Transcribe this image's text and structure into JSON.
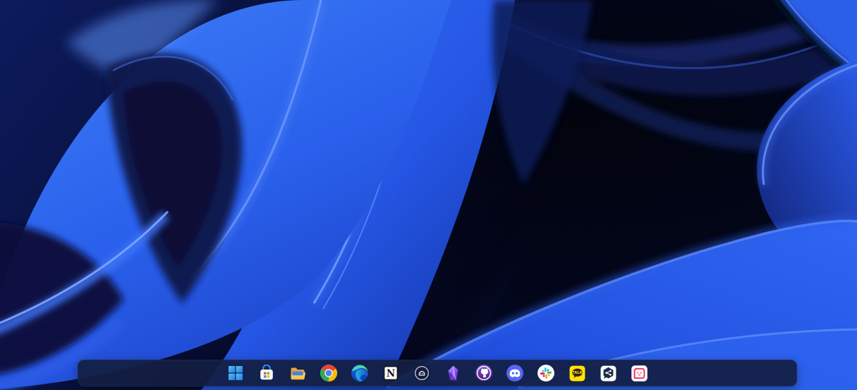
{
  "desktop": {
    "wallpaper": {
      "style": "Windows 11 bloom abstract blue ribbons",
      "colors": {
        "bright_blue": "#2e68f2",
        "highlight_blue": "#7fa7ff",
        "mid_blue": "#1a3ec2",
        "deep_navy": "#070d33",
        "near_black": "#03061a"
      }
    }
  },
  "taskbar": {
    "alignment": "center",
    "background": "#131e42",
    "items": [
      {
        "id": "start",
        "label": "Start"
      },
      {
        "id": "microsoft-store",
        "label": "Microsoft Store"
      },
      {
        "id": "file-explorer",
        "label": "File Explorer"
      },
      {
        "id": "chrome",
        "label": "Google Chrome"
      },
      {
        "id": "edge",
        "label": "Microsoft Edge"
      },
      {
        "id": "notion",
        "label": "Notion"
      },
      {
        "id": "ghost-circle-app",
        "label": "Ghost-face circle app"
      },
      {
        "id": "obsidian",
        "label": "Obsidian"
      },
      {
        "id": "github-desktop",
        "label": "GitHub Desktop"
      },
      {
        "id": "discord",
        "label": "Discord"
      },
      {
        "id": "slack",
        "label": "Slack"
      },
      {
        "id": "kakaotalk",
        "label": "KakaoTalk",
        "badge_text": "TALK"
      },
      {
        "id": "hex-share-chat-app",
        "label": "Chat app (hexagon share bubble)"
      },
      {
        "id": "red-bubble-chat-app",
        "label": "Chat app (red loop bubble)"
      }
    ],
    "brand_colors": {
      "start_blue_light": "#58c4f5",
      "start_blue_dark": "#1f7ae8",
      "store_red": "#f25022",
      "store_green": "#7fba00",
      "store_blue": "#00a4ef",
      "store_yellow": "#ffb900",
      "chrome_red": "#ea4335",
      "chrome_green": "#34a853",
      "chrome_yellow": "#fbbc05",
      "chrome_blue": "#4285f4",
      "discord_blurple": "#5865f2",
      "slack_blue": "#36c5f0",
      "slack_green": "#2eb67d",
      "slack_red": "#e01e5a",
      "slack_yellow": "#ecb22e",
      "kakao_yellow": "#fde500",
      "kakao_brown": "#3a1d1d",
      "obsidian_purple": "#7c3aed",
      "red_bubble": "#f0355c",
      "hex_navy": "#1e2c4a"
    }
  }
}
